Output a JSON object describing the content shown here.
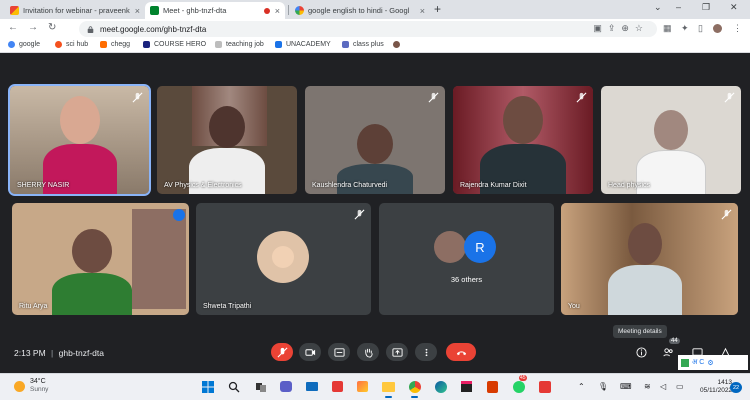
{
  "browser": {
    "tabs": [
      {
        "title": "Invitation for webinar - praveenk",
        "favicon": "gmail-icon",
        "active": false
      },
      {
        "title": "Meet - ghb-tnzf-dta",
        "favicon": "meet-icon",
        "active": true
      },
      {
        "title": "google english to hindi - Googl",
        "favicon": "google-icon",
        "active": false
      }
    ],
    "new_tab": "+",
    "url": "meet.google.com/ghb-tnzf-dta"
  },
  "bookmarks": [
    {
      "label": "google",
      "color": "#4285f4"
    },
    {
      "label": "sci hub",
      "color": "#f4511e"
    },
    {
      "label": "chegg",
      "color": "#ff6d00"
    },
    {
      "label": "COURSE HERO",
      "color": "#1a237e"
    },
    {
      "label": "teaching job",
      "color": "#9e9e9e"
    },
    {
      "label": "UNACADEMY",
      "color": "#1a73e8"
    },
    {
      "label": "class plus",
      "color": "#5c6bc0"
    },
    {
      "label": "",
      "color": "#795548"
    }
  ],
  "meet": {
    "participants": [
      {
        "name": "SHERRY NASIR",
        "muted": true,
        "speaking": true
      },
      {
        "name": "AV Physics & Electronics",
        "muted": false
      },
      {
        "name": "Kaushlendra Chaturvedi",
        "muted": true
      },
      {
        "name": "Rajendra Kumar Dixit",
        "muted": true
      },
      {
        "name": "Head physics",
        "muted": true
      },
      {
        "name": "Ritu Arya",
        "muted": false
      },
      {
        "name": "Shweta Tripathi",
        "muted": true
      },
      {
        "name": "You",
        "muted": true
      }
    ],
    "others": {
      "avatar_letter": "R",
      "label": "36 others"
    },
    "time": "2:13 PM",
    "meeting_code": "ghb-tnzf-dta",
    "tooltip": "Meeting details",
    "people_count": "44",
    "tray_letters": "अ C",
    "colors": {
      "accent": "#8ab4f8",
      "end_call": "#ea4335",
      "avatar_r": "#1a73e8"
    }
  },
  "taskbar": {
    "temperature": "34°C",
    "weather": "Sunny",
    "clock_time": "1413",
    "clock_date": "05/11/2022",
    "notifications": "22",
    "app_badge": "45"
  }
}
